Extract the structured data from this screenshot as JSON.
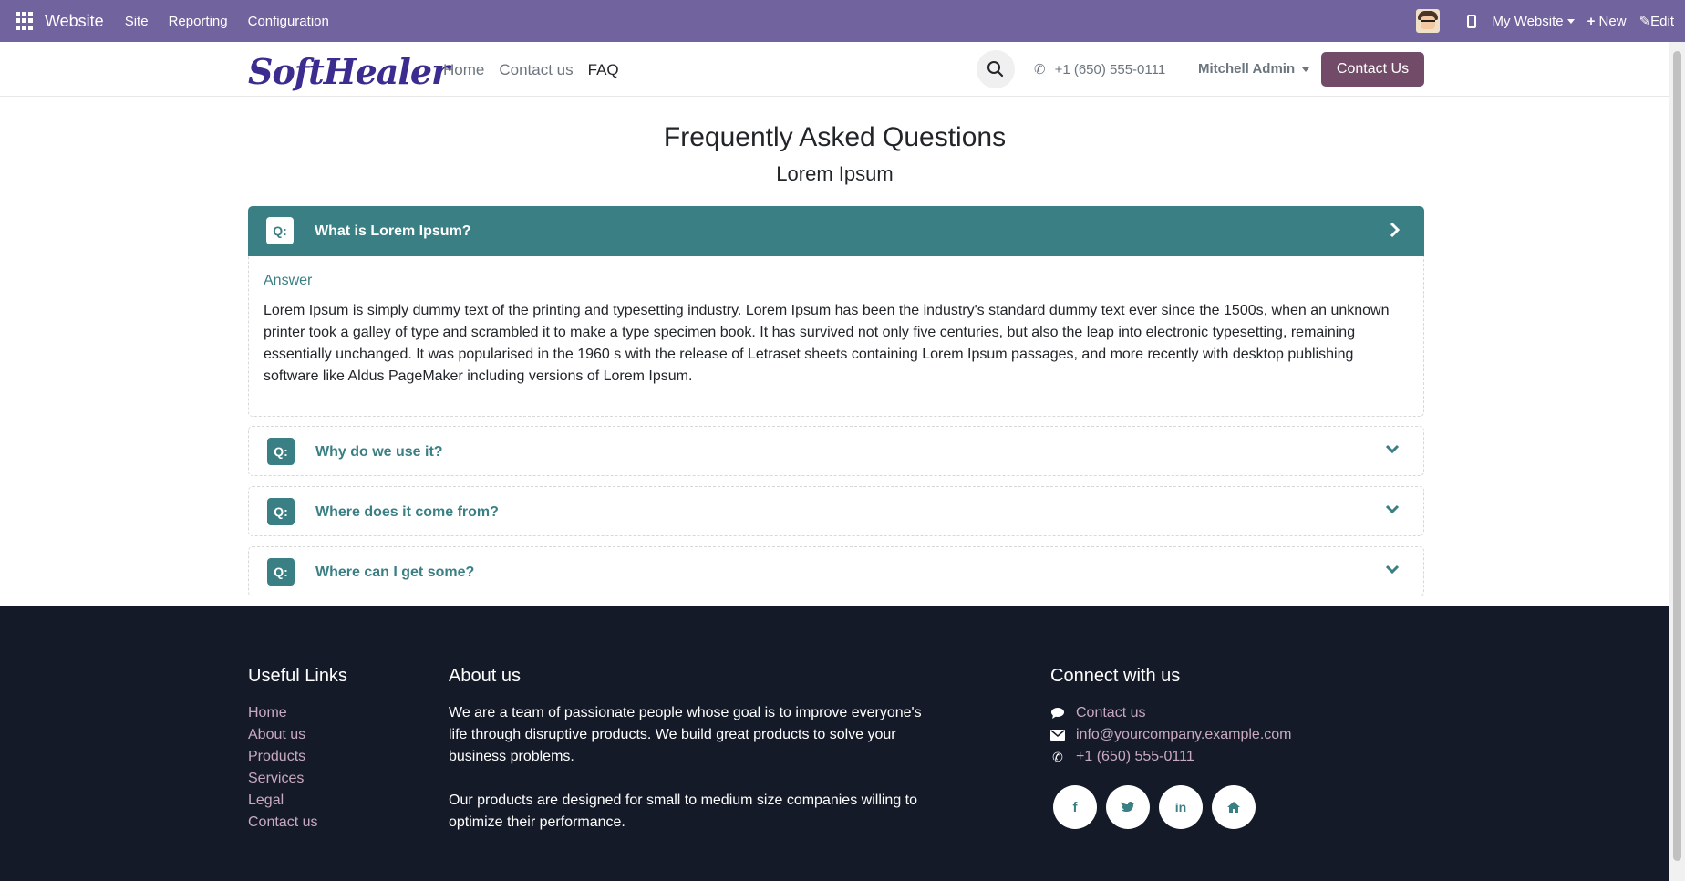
{
  "adminbar": {
    "app_name": "Website",
    "menu": [
      "Site",
      "Reporting",
      "Configuration"
    ],
    "website_selector": "My Website",
    "new_label": "New",
    "edit_label": "Edit"
  },
  "navbar": {
    "logo_text": "SoftHealer",
    "links": [
      "Home",
      "Contact us",
      "FAQ"
    ],
    "active_link": "FAQ",
    "phone": "+1 (650) 555-0111",
    "user": "Mitchell Admin",
    "cta": "Contact Us"
  },
  "page": {
    "title": "Frequently Asked Questions",
    "subtitle": "Lorem Ipsum"
  },
  "faq": {
    "badge": "Q:",
    "answer_label": "Answer",
    "open": {
      "question": "What is Lorem Ipsum?",
      "answer": "Lorem Ipsum is simply dummy text of the printing and typesetting industry. Lorem Ipsum has been the industry's standard dummy text ever since the 1500s, when an unknown printer took a galley of type and scrambled it to make a type specimen book. It has survived not only five centuries, but also the leap into electronic typesetting, remaining essentially unchanged. It was popularised in the 1960 s with the release of Letraset sheets containing Lorem Ipsum passages, and more recently with desktop publishing software like Aldus PageMaker including versions of Lorem Ipsum."
    },
    "collapsed": [
      "Why do we use it?",
      "Where does it come from?",
      "Where can I get some?"
    ]
  },
  "footer": {
    "useful_links_title": "Useful Links",
    "useful_links": [
      "Home",
      "About us",
      "Products",
      "Services",
      "Legal",
      "Contact us"
    ],
    "about_title": "About us",
    "about_p1": "We are a team of passionate people whose goal is to improve everyone's life through disruptive products. We build great products to solve your business problems.",
    "about_p2": "Our products are designed for small to medium size companies willing to optimize their performance.",
    "connect_title": "Connect with us",
    "connect_contact": "Contact us",
    "connect_email": "info@yourcompany.example.com",
    "connect_phone": "+1 (650) 555-0111",
    "social": [
      "facebook-icon",
      "twitter-icon",
      "linkedin-icon",
      "home-icon"
    ]
  },
  "colors": {
    "admin_bar": "#71639e",
    "accent_teal": "#3a7f84",
    "cta_purple": "#714b67",
    "footer_bg": "#141a28",
    "footer_link": "#c7a9c0"
  }
}
